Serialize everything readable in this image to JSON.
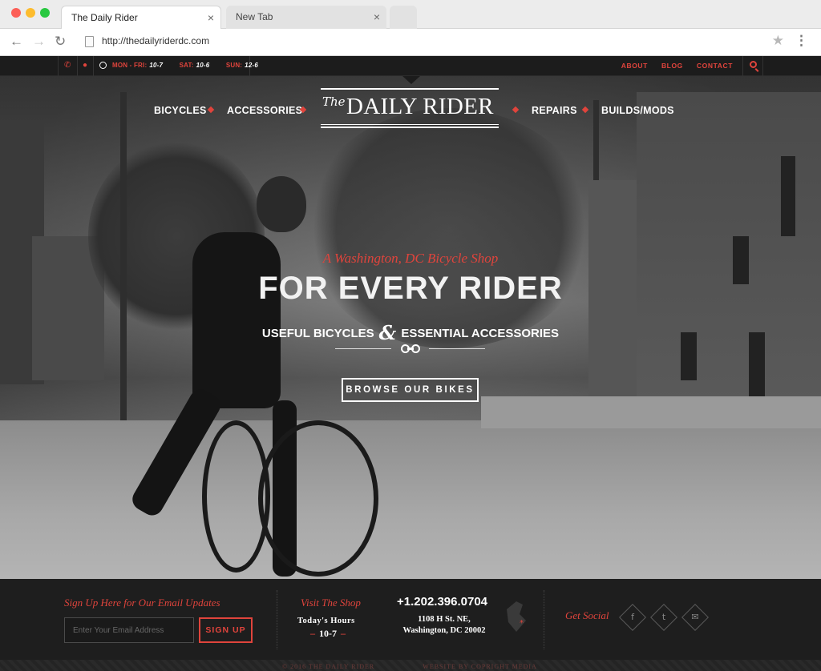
{
  "browser": {
    "active_tab": "The Daily Rider",
    "inactive_tab": "New Tab",
    "close_glyph": "×",
    "url": "http://thedailyriderdc.com"
  },
  "topbar": {
    "hours": [
      {
        "label": "MON - FRI:",
        "value": "10-7"
      },
      {
        "label": "SAT:",
        "value": "10-6"
      },
      {
        "label": "SUN:",
        "value": "12-6"
      }
    ],
    "links": [
      "ABOUT",
      "BLOG",
      "CONTACT"
    ]
  },
  "nav": {
    "left": [
      "BICYCLES",
      "ACCESSORIES"
    ],
    "right": [
      "REPAIRS",
      "BUILDS/MODS"
    ]
  },
  "logo": {
    "the": "The",
    "name": "DAILY RIDER"
  },
  "hero": {
    "tagline": "A Washington, DC Bicycle Shop",
    "headline": "FOR EVERY RIDER",
    "sub_left": "USEFUL BICYCLES",
    "sub_amp": "&",
    "sub_right": "ESSENTIAL ACCESSORIES",
    "button": "BROWSE OUR BIKES"
  },
  "footer": {
    "signup_title": "Sign Up Here for Our Email Updates",
    "email_placeholder": "Enter Your Email Address",
    "signup_button": "SIGN UP",
    "visit_title": "Visit The Shop",
    "today_label": "Today's Hours",
    "today_hours": "10-7",
    "phone": "+1.202.396.0704",
    "address_line1": "1108 H St. NE,",
    "address_line2": "Washington, DC 20002",
    "social_title": "Get Social",
    "copyright": "© 2016 THE DAILY RIDER",
    "credit": "WEBSITE BY COPRIGHT MEDIA"
  },
  "colors": {
    "accent": "#e0443c",
    "dark": "#1e1e1e"
  },
  "icons": [
    "phone-icon",
    "map-pin-icon",
    "clock-icon",
    "search-icon",
    "chain-link-icon",
    "dc-map-icon",
    "facebook-icon",
    "twitter-icon",
    "email-icon"
  ]
}
